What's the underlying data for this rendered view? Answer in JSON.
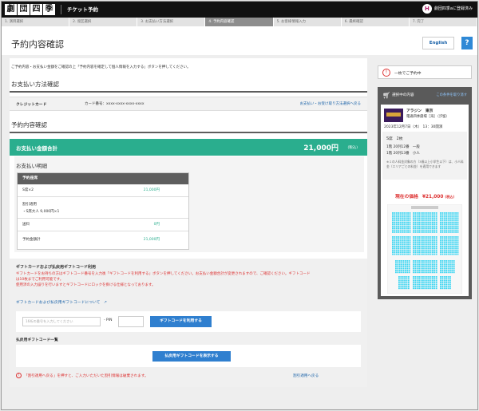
{
  "header": {
    "logo_chars": [
      "劇",
      "団",
      "四",
      "季"
    ],
    "site_name": "チケット予約",
    "user_icon": "H",
    "user_name": "劇団四季aに登録済み"
  },
  "steps": [
    "1. 演目選択",
    "2. 席区選択",
    "3. お支払い方法選択",
    "4. 予約内容確認",
    "5. お客様情報入力",
    "6. 最終確認",
    "7. 完了"
  ],
  "active_step": 3,
  "page": {
    "title": "予約内容確認",
    "english_button": "English",
    "help_button": "?"
  },
  "main": {
    "note": "ご予約内容・お支払い金額をご確認の上「予約内容を確定して個人情報を入力する」ボタンを押してください。",
    "payment_heading": "お支払い方法確認",
    "payment_method_label": "クレジットカード",
    "card_number": "カード番号：xxxx-xxxx-xxxx-xxxx",
    "payment_back_link": "お支払い・お受け取り方法選択へ戻る",
    "reservation_heading": "予約内容確認",
    "total_label": "お支払い金額合計",
    "total_amount": "21,000円",
    "total_tax": "(税込)",
    "breakdown_title": "お支払い明細",
    "breakdown_head": "予約座席",
    "rows": {
      "seat_label": "S席×2",
      "seat_value": "21,000円",
      "discount_label": "割引適用",
      "discount_detail": "・S席大人 9,000円×1",
      "fee_label": "送料",
      "fee_value": "0円",
      "total_label": "予約金額計",
      "total_value": "21,000円"
    },
    "gift": {
      "heading": "ギフトカードおよび払戻用ギフトコード利用",
      "warning_1": "ギフトカードをお持ちの方はギフトコード番号を入力後「ギフトコードを利用する」ボタンを押してください。お支払い金額合計が変更されますので、ご確認ください。ギフトコード",
      "warning_2": "は10枚までご利用可能です。",
      "warning_3": "使用済の入力誤りを行いますとギフトコードにロックを掛ける仕様となっております。",
      "link": "ギフトカードおよび払戻用ギフトコードについて",
      "input_placeholder": "16桁の番号を入力してください",
      "pin_label": "- PIN",
      "apply_button": "ギフトコードを利用する",
      "list_heading": "払戻用ギフトコード一覧",
      "show_button": "払戻用ギフトコードを表示する",
      "bottom_note": "「割引適用へ戻る」を押すと、ご入力いただいた割引情報は破棄されます。",
      "back_link": "割引適用へ戻る"
    }
  },
  "sidebar": {
    "reserving": "一枚でご予約中",
    "selected_title": "選択中の内容",
    "change_link": "この条件を取り消す",
    "show_title": "アラジン　東京",
    "venue": "電通四季劇場［海］（汐留）",
    "date": "2023年12月7日（木） 13：30開演",
    "seat_class": "S席　2枚",
    "seat_1": "1階 20列12番　一般",
    "seat_2": "1階 20列13番　小人",
    "seat_note": "※１の人料金対象の方（3歳以上小学生以下）は、小人料金（エリアごとの料金）を適用できます",
    "current_price_label": "現在の価格",
    "current_price": "¥21,000",
    "current_price_tax": "(税込)"
  },
  "colors": {
    "teal": "#2aae8e",
    "link": "#1a62a8",
    "button_blue": "#2f7fcf",
    "warning_red": "#d33",
    "seat_cyan": "#3ed6f2"
  }
}
